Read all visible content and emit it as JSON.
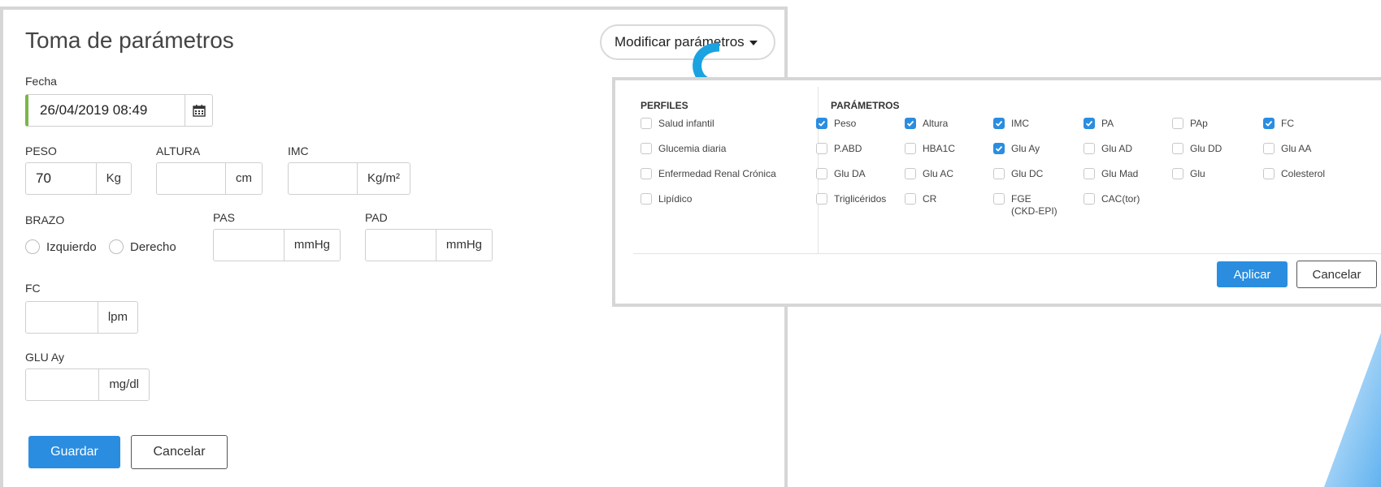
{
  "left": {
    "title": "Toma de parámetros",
    "modify_button": "Modificar parámetros",
    "fecha": {
      "label": "Fecha",
      "value": "26/04/2019 08:49"
    },
    "peso": {
      "label": "PESO",
      "value": "70",
      "unit": "Kg"
    },
    "altura": {
      "label": "ALTURA",
      "value": "",
      "unit": "cm"
    },
    "imc": {
      "label": "IMC",
      "value": "",
      "unit": "Kg/m²"
    },
    "brazo": {
      "label": "BRAZO",
      "options": [
        "Izquierdo",
        "Derecho"
      ]
    },
    "pas": {
      "label": "PAS",
      "value": "",
      "unit": "mmHg"
    },
    "pad": {
      "label": "PAD",
      "value": "",
      "unit": "mmHg"
    },
    "fc": {
      "label": "FC",
      "value": "",
      "unit": "lpm"
    },
    "glu": {
      "label": "GLU Ay",
      "value": "",
      "unit": "mg/dl"
    },
    "save_button": "Guardar",
    "cancel_button": "Cancelar"
  },
  "popup": {
    "profiles_header": "PERFILES",
    "params_header": "PARÁMETROS",
    "profiles": [
      {
        "label": "Salud infantil",
        "checked": false
      },
      {
        "label": "Glucemia diaria",
        "checked": false
      },
      {
        "label": "Enfermedad Renal Crónica",
        "checked": false
      },
      {
        "label": "Lipídico",
        "checked": false
      }
    ],
    "params": [
      {
        "label": "Peso",
        "checked": true
      },
      {
        "label": "Altura",
        "checked": true
      },
      {
        "label": "IMC",
        "checked": true
      },
      {
        "label": "PA",
        "checked": true
      },
      {
        "label": "PAp",
        "checked": false
      },
      {
        "label": "FC",
        "checked": true
      },
      {
        "label": "P.ABD",
        "checked": false
      },
      {
        "label": "HBA1C",
        "checked": false
      },
      {
        "label": "Glu Ay",
        "checked": true
      },
      {
        "label": "Glu AD",
        "checked": false
      },
      {
        "label": "Glu DD",
        "checked": false
      },
      {
        "label": "Glu AA",
        "checked": false
      },
      {
        "label": "Glu DA",
        "checked": false
      },
      {
        "label": "Glu AC",
        "checked": false
      },
      {
        "label": "Glu DC",
        "checked": false
      },
      {
        "label": "Glu Mad",
        "checked": false
      },
      {
        "label": "Glu",
        "checked": false
      },
      {
        "label": "Colesterol",
        "checked": false
      },
      {
        "label": "Triglicéridos",
        "checked": false
      },
      {
        "label": "CR",
        "checked": false
      },
      {
        "label": "FGE",
        "sublabel": "(CKD-EPI)",
        "checked": false
      },
      {
        "label": "CAC(tor)",
        "checked": false
      }
    ],
    "apply_button": "Aplicar",
    "cancel_button": "Cancelar"
  },
  "colors": {
    "accent": "#2a8de0",
    "date_marker": "#7ab648",
    "arrow": "#1aa3e0"
  }
}
